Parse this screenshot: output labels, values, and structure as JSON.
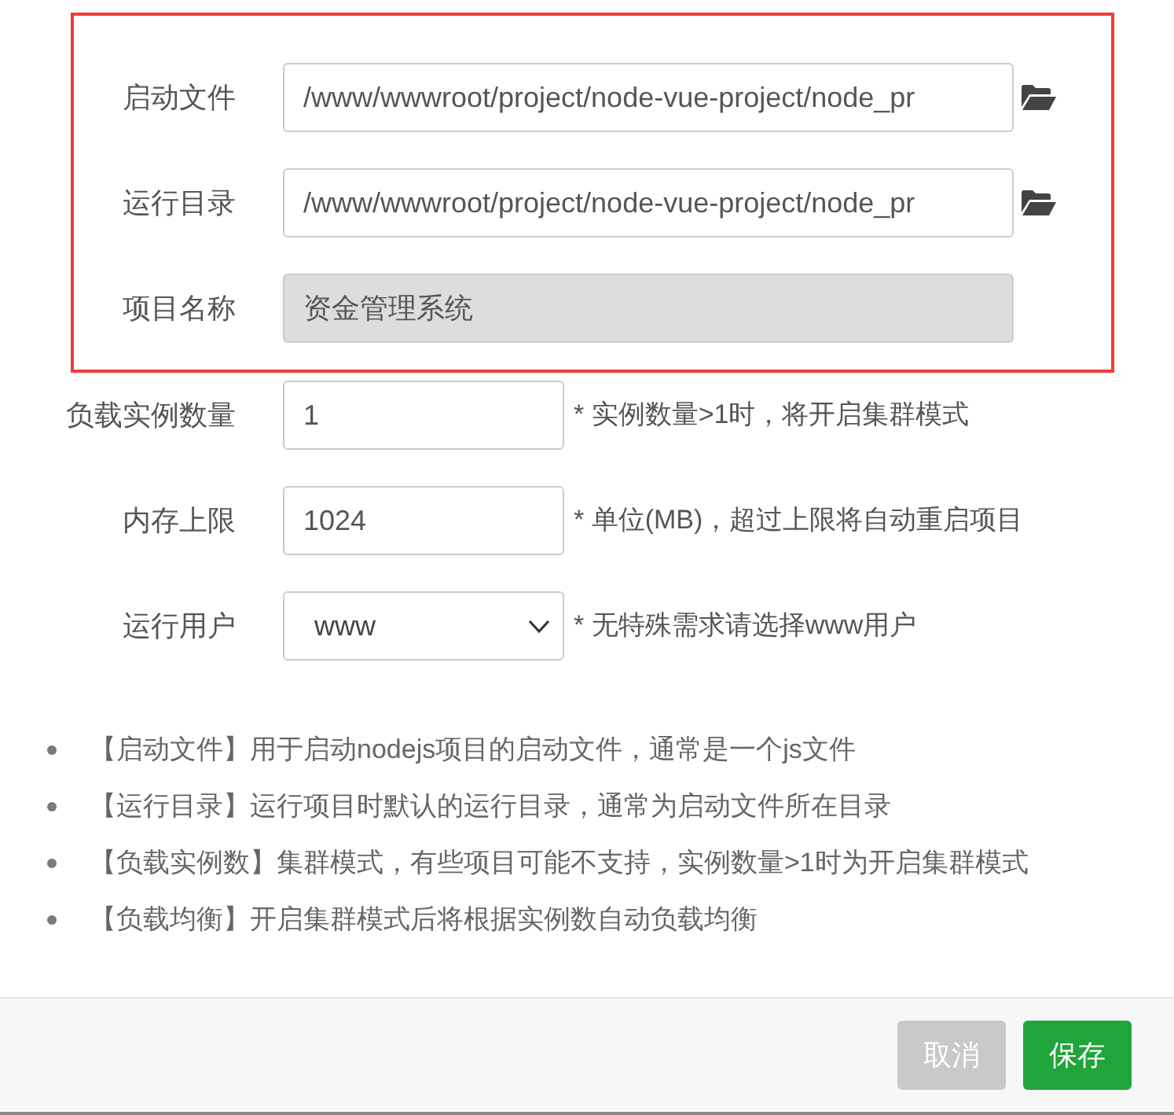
{
  "form": {
    "fields": [
      {
        "kind": "path",
        "label": "启动文件",
        "value": "/www/wwwroot/project/node-vue-project/node_pr",
        "disabled": false,
        "highlighted": true
      },
      {
        "kind": "path",
        "label": "运行目录",
        "value": "/www/wwwroot/project/node-vue-project/node_pr",
        "disabled": false,
        "highlighted": true
      },
      {
        "kind": "text",
        "label": "项目名称",
        "value": "资金管理系统",
        "disabled": true,
        "highlighted": true
      },
      {
        "kind": "text",
        "label": "负载实例数量",
        "value": "1",
        "hint": "* 实例数量>1时，将开启集群模式",
        "disabled": false,
        "highlighted": false
      },
      {
        "kind": "text",
        "label": "内存上限",
        "value": "1024",
        "hint": "* 单位(MB)，超过上限将自动重启项目",
        "disabled": false,
        "highlighted": false
      },
      {
        "kind": "select",
        "label": "运行用户",
        "value": "www",
        "hint": "* 无特殊需求请选择www用户",
        "disabled": false,
        "highlighted": false
      }
    ]
  },
  "notes": [
    "【启动文件】用于启动nodejs项目的启动文件，通常是一个js文件",
    "【运行目录】运行项目时默认的运行目录，通常为启动文件所在目录",
    "【负载实例数】集群模式，有些项目可能不支持，实例数量>1时为开启集群模式",
    "【负载均衡】开启集群模式后将根据实例数自动负载均衡"
  ],
  "footer": {
    "buttons": [
      {
        "kind": "cancel",
        "label": "取消"
      },
      {
        "kind": "primary",
        "label": "保存"
      }
    ]
  }
}
